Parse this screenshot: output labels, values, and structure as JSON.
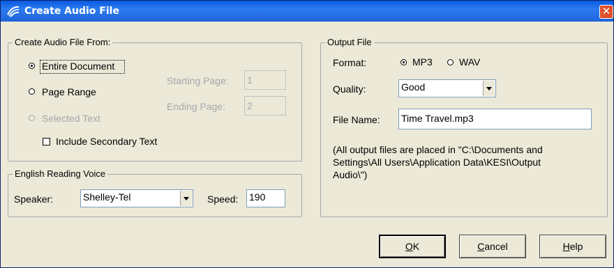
{
  "window": {
    "title": "Create Audio File",
    "close_label": "✕"
  },
  "source_group": {
    "title": "Create Audio File From:",
    "entire_document": "Entire Document",
    "page_range": "Page Range",
    "selected_text": "Selected Text",
    "starting_page_label": "Starting Page:",
    "starting_page_value": "1",
    "ending_page_label": "Ending Page:",
    "ending_page_value": "2",
    "include_secondary": "Include Secondary Text",
    "selected_option": "entire_document",
    "include_secondary_checked": false
  },
  "voice_group": {
    "title": "English Reading Voice",
    "speaker_label": "Speaker:",
    "speaker_value": "Shelley-Tel",
    "speed_label": "Speed:",
    "speed_value": "190"
  },
  "output_group": {
    "title": "Output File",
    "format_label": "Format:",
    "mp3": "MP3",
    "wav": "WAV",
    "format_selected": "MP3",
    "quality_label": "Quality:",
    "quality_value": "Good",
    "filename_label": "File Name:",
    "filename_value": "Time Travel.mp3",
    "note_line1": "(All output files are placed in \"C:\\Documents and",
    "note_line2": "Settings\\All Users\\Application Data\\KESI\\Output",
    "note_line3": "Audio\\\")"
  },
  "buttons": {
    "ok_mnemonic": "O",
    "ok_rest": "K",
    "cancel_mnemonic": "C",
    "cancel_rest": "ancel",
    "help_mnemonic": "H",
    "help_rest": "elp"
  }
}
